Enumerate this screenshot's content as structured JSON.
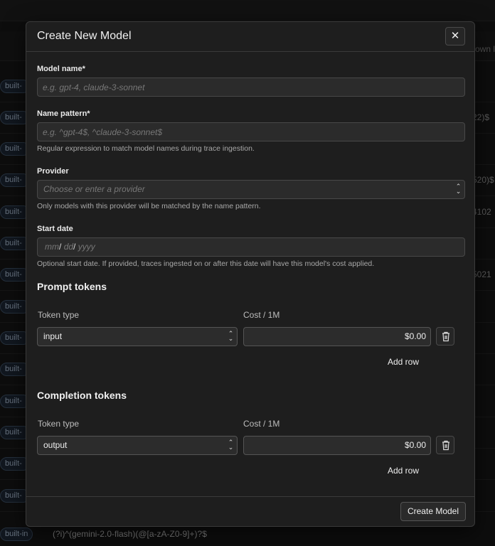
{
  "background": {
    "header_partial": "own l",
    "badge_label": "built-in",
    "rows": [
      {
        "pattern": ""
      },
      {
        "pattern": "22)$"
      },
      {
        "pattern": ""
      },
      {
        "pattern": "520)$"
      },
      {
        "pattern": "4102"
      },
      {
        "pattern": ""
      },
      {
        "pattern": "5021"
      },
      {
        "pattern": ""
      },
      {
        "pattern": ""
      },
      {
        "pattern": ""
      },
      {
        "pattern": ""
      },
      {
        "pattern": ""
      },
      {
        "pattern": ""
      },
      {
        "pattern": ""
      }
    ],
    "last_row_pattern": "(?i)^(gemini-2.0-flash)(@[a-zA-Z0-9]+)?$"
  },
  "modal": {
    "title": "Create New Model",
    "close_label": "✕",
    "model_name": {
      "label": "Model name*",
      "placeholder": "e.g. gpt-4, claude-3-sonnet",
      "value": ""
    },
    "name_pattern": {
      "label": "Name pattern*",
      "placeholder": "e.g. ^gpt-4$, ^claude-3-sonnet$",
      "value": "",
      "help": "Regular expression to match model names during trace ingestion."
    },
    "provider": {
      "label": "Provider",
      "placeholder": "Choose or enter a provider",
      "help": "Only models with this provider will be matched by the name pattern."
    },
    "start_date": {
      "label": "Start date",
      "mm": "mm",
      "dd": "dd",
      "yyyy": "yyyy",
      "sep": "/",
      "help": "Optional start date. If provided, traces ingested on or after this date will have this model's cost applied."
    },
    "prompt_tokens": {
      "title": "Prompt tokens",
      "col_type": "Token type",
      "col_cost": "Cost / 1M",
      "rows": [
        {
          "type": "input",
          "cost": "$0.00"
        }
      ],
      "add_row": "Add row"
    },
    "completion_tokens": {
      "title": "Completion tokens",
      "col_type": "Token type",
      "col_cost": "Cost / 1M",
      "rows": [
        {
          "type": "output",
          "cost": "$0.00"
        }
      ],
      "add_row": "Add row"
    },
    "create_button": "Create Model"
  }
}
